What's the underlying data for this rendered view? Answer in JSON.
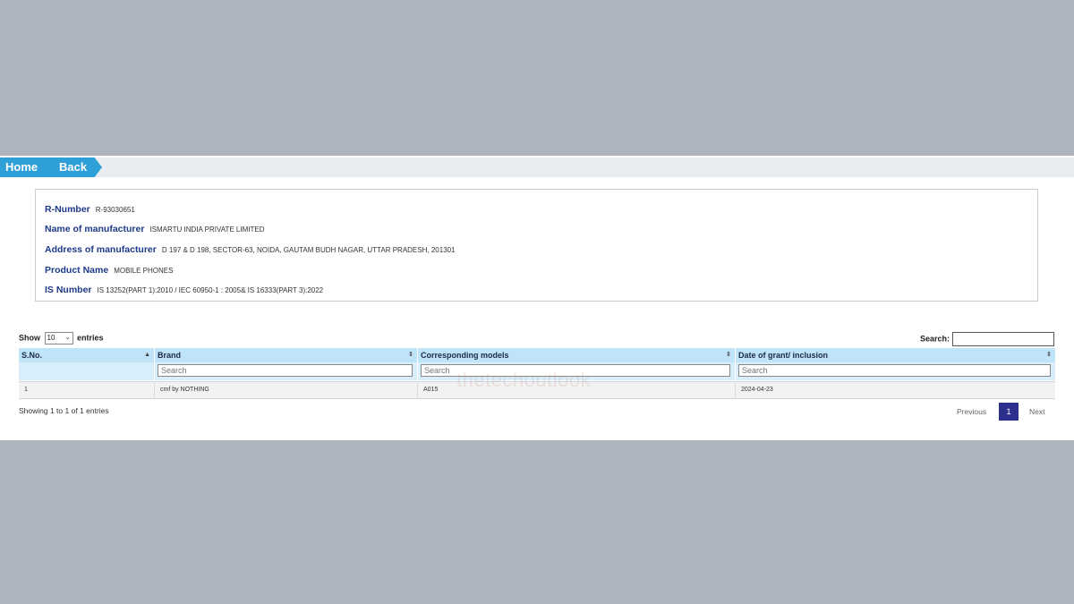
{
  "nav": {
    "home": "Home",
    "back": "Back"
  },
  "details": [
    {
      "label": "R-Number",
      "value": "R-93030651"
    },
    {
      "label": "Name of manufacturer",
      "value": "ISMARTU INDIA PRIVATE LIMITED"
    },
    {
      "label": "Address of manufacturer",
      "value": "D 197 & D 198, SECTOR-63, NOIDA, GAUTAM BUDH NAGAR, UTTAR PRADESH, 201301"
    },
    {
      "label": "Product Name",
      "value": "MOBILE PHONES"
    },
    {
      "label": "IS Number",
      "value": "IS 13252(PART 1):2010 / IEC 60950-1 : 2005& IS 16333(PART 3):2022"
    }
  ],
  "controls": {
    "show_label": "Show",
    "entries_label": "entries",
    "page_size": "10",
    "search_label": "Search:"
  },
  "table": {
    "headers": [
      "S.No.",
      "Brand",
      "Corresponding models",
      "Date of grant/ inclusion"
    ],
    "filter_placeholder": "Search",
    "rows": [
      [
        "1",
        "cmf by NOTHING",
        "A015",
        "2024-04-23"
      ]
    ]
  },
  "footer": {
    "info": "Showing 1 to 1 of 1 entries",
    "previous": "Previous",
    "page": "1",
    "next": "Next"
  },
  "watermark": "thetechoutlook",
  "colors": {
    "accent": "#2f9fd8",
    "header": "#bfe3f7",
    "label": "#1d3a8a",
    "page_active": "#2c2f8c"
  }
}
